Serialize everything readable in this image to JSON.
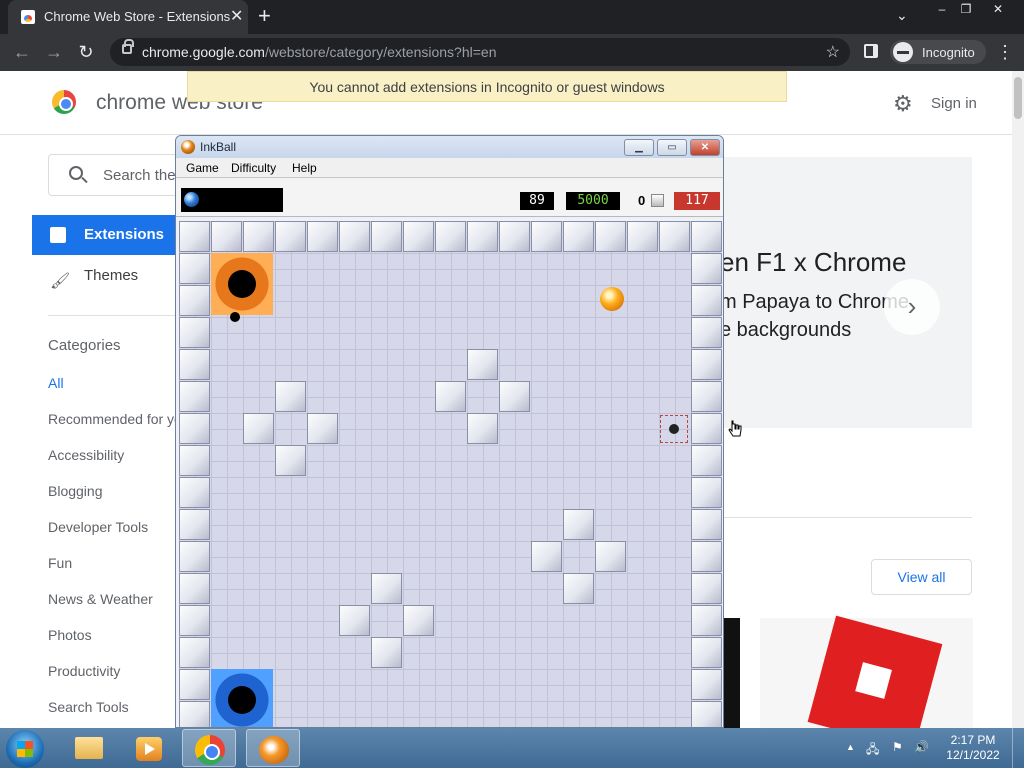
{
  "browser": {
    "tab_title": "Chrome Web Store - Extensions",
    "tab_close": "✕",
    "new_tab": "+",
    "tab_dropdown": "⌄",
    "win_min": "‒",
    "win_restore": "❐",
    "win_close": "✕",
    "url_host": "chrome.google.com",
    "url_path": "/webstore/category/extensions?hl=en",
    "incognito_label": "Incognito",
    "back": "←",
    "forward": "→",
    "reload": "↻",
    "star": "☆",
    "menu": "⋮"
  },
  "store": {
    "name": "chrome web store",
    "sign_in": "Sign in",
    "incognito_notice": "You cannot add extensions in Incognito or guest windows",
    "search_placeholder": "Search the store",
    "nav": [
      {
        "label": "Extensions"
      },
      {
        "label": "Themes"
      }
    ],
    "categories_heading": "Categories",
    "categories": [
      "All",
      "Recommended for you",
      "Accessibility",
      "Blogging",
      "Developer Tools",
      "Fun",
      "News & Weather",
      "Photos",
      "Productivity",
      "Search Tools"
    ],
    "banner": {
      "line1": "en F1 x Chrome",
      "line2": "m Papaya to Chrome",
      "line3": "e backgrounds",
      "next": "›"
    },
    "view_all": "View all"
  },
  "inkball": {
    "title": "InkBall",
    "menu": [
      "Game",
      "Difficulty",
      "Help"
    ],
    "time": "89",
    "score": "5000",
    "bricks": "0",
    "high": "117",
    "colors": {
      "time": "#ffffff",
      "score": "#7cd34a",
      "high": "#ffffff",
      "high_bg": "#c8372d"
    }
  },
  "taskbar": {
    "clock_time": "2:17 PM",
    "clock_date": "12/1/2022",
    "apps": [
      "explorer",
      "media-player",
      "chrome",
      "inkball"
    ],
    "tray_up": "▲"
  },
  "colors": {
    "accent": "#1a73e8",
    "chrome_dark": "#35363a",
    "notice_bg": "#f9f0c5"
  }
}
